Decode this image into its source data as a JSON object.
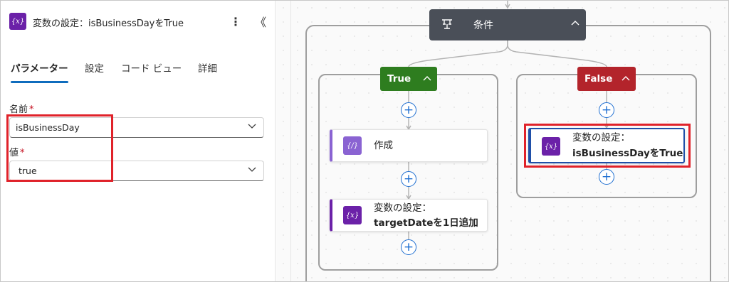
{
  "panel": {
    "title": "変数の設定：isBusinessDayをTrue",
    "icon_symbol": "{x}",
    "more_glyph": "⋮",
    "collapse_glyph": "《",
    "tabs": [
      {
        "label": "パラメーター",
        "active": true
      },
      {
        "label": "設定",
        "active": false
      },
      {
        "label": "コード ビュー",
        "active": false
      },
      {
        "label": "詳細",
        "active": false
      }
    ],
    "fields": {
      "name": {
        "label": "名前",
        "required_mark": "*",
        "value": "isBusinessDay"
      },
      "value": {
        "label": "値",
        "required_mark": "*",
        "value": "true"
      }
    }
  },
  "canvas": {
    "condition": {
      "label": "条件",
      "icon": "condition-icon"
    },
    "true_branch": {
      "label": "True"
    },
    "false_branch": {
      "label": "False"
    },
    "actions": {
      "compose": {
        "symbol": "{/}",
        "label": "作成"
      },
      "set_target": {
        "symbol": "{x}",
        "line1": "変数の設定：",
        "line2": "targetDateを1日追加"
      },
      "set_business": {
        "symbol": "{x}",
        "line1": "変数の設定：",
        "line2": "isBusinessDayをTrue"
      }
    },
    "add_glyph": "+"
  },
  "colors": {
    "accent": "#0f6cbd",
    "variable_icon": "#6b21a8",
    "true_green": "#2e7d1f",
    "false_red": "#b3242b",
    "condition_gray": "#4a4f58",
    "highlight_red": "#e0222a"
  }
}
